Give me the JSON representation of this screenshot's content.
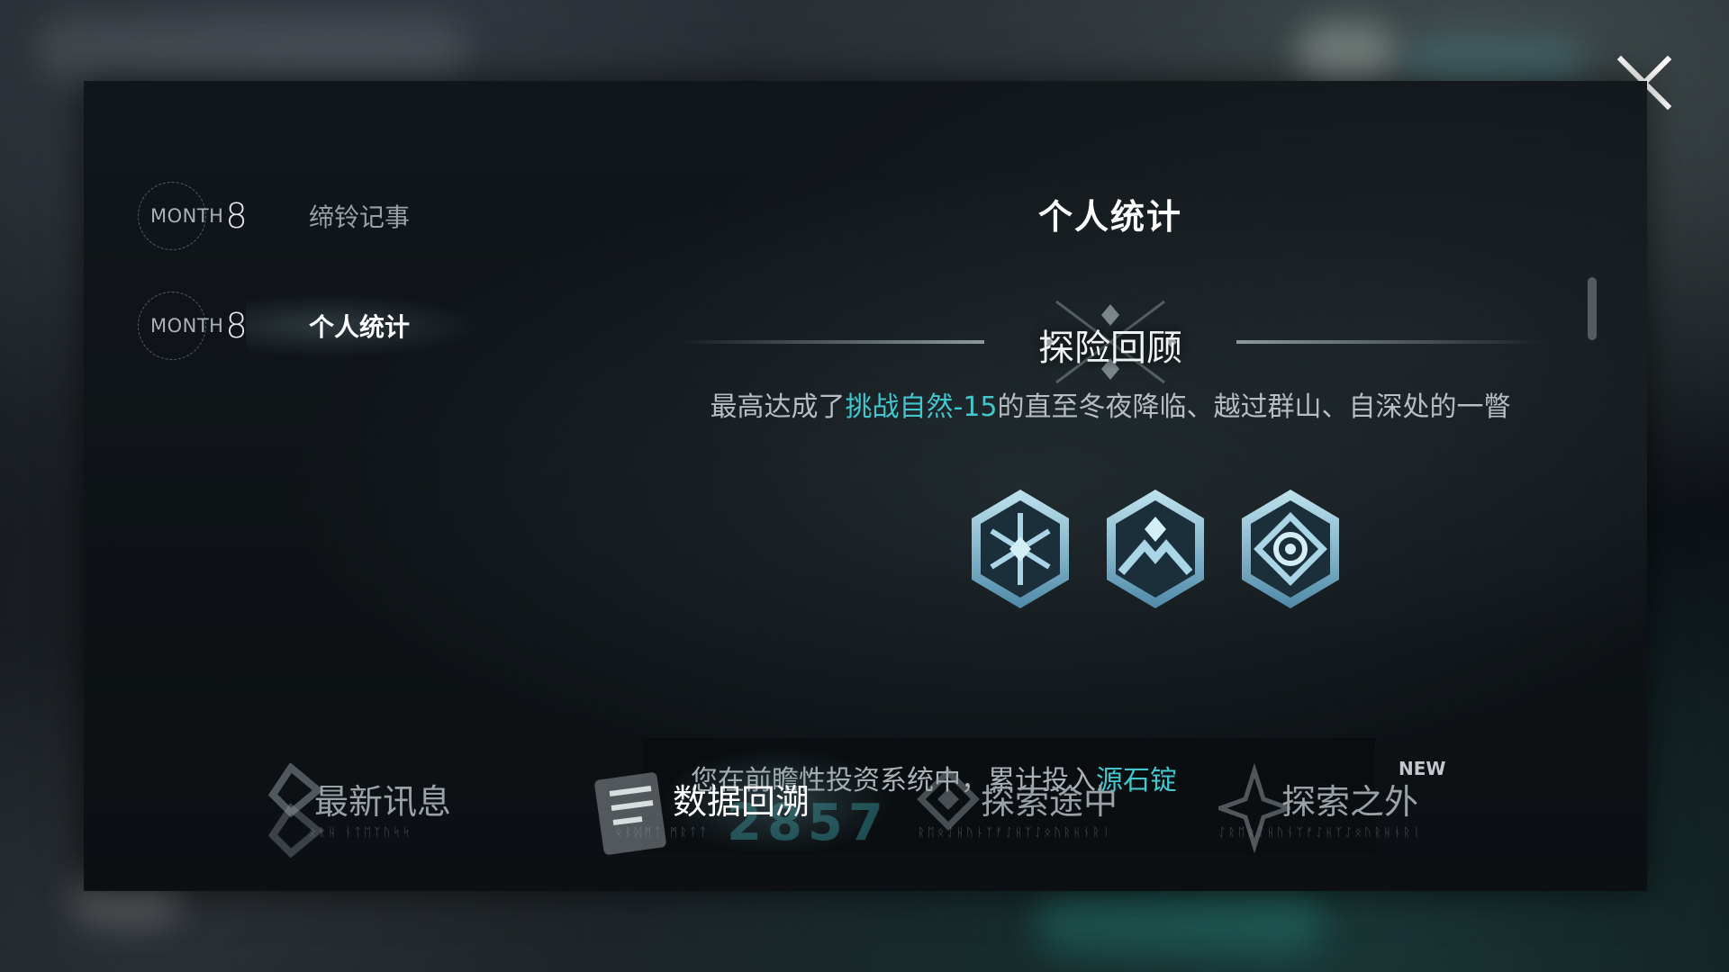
{
  "window": {
    "close_icon": "close-icon"
  },
  "side_nav": {
    "items": [
      {
        "month_word": "MONTH",
        "month_num": "8",
        "label": "缔铃记事",
        "active": false
      },
      {
        "month_word": "MONTH",
        "month_num": "8",
        "label": "个人统计",
        "active": true
      }
    ]
  },
  "content": {
    "title": "个人统计",
    "section_title": "探险回顾",
    "achievement": {
      "prefix": "最高达成了",
      "highlight": "挑战自然-15",
      "suffix": "的直至冬夜降临、越过群山、自深处的一瞥"
    },
    "badges": [
      "winter-night-badge-icon",
      "mountains-badge-icon",
      "depths-eye-badge-icon"
    ],
    "invest": {
      "prefix": "您在前瞻性投资系统中，累计投入",
      "highlight": "源石锭",
      "number": "2857"
    }
  },
  "bottom_tabs": [
    {
      "label": "最新讯息",
      "runes": "ᛟᚱᚺ ᚾᛏᛖᛉᚢᛋᛋ",
      "icon": "news-icon",
      "active": false,
      "new": ""
    },
    {
      "label": "数据回溯",
      "runes": "ᛟᛒᛞᛗᛏ ᛗᚱᛏᛏ",
      "icon": "data-review-icon",
      "active": true,
      "new": ""
    },
    {
      "label": "探索途中",
      "runes": "ᚱᛖᛟᛇᚺᚢᚾᛉᚠᛇᚺᛉᛇᛟᚢᚱᚺᚾᚱᛁ",
      "icon": "exploring-icon",
      "active": false,
      "new": ""
    },
    {
      "label": "探索之外",
      "runes": "ᛇᚱᛖᛟᛇᚺᚢᚾᛉᚠᛇᚺᛉᛇᛟᚢᚱᚺᚾᚱᛁ",
      "icon": "beyond-exploration-icon",
      "active": false,
      "new": "NEW"
    }
  ],
  "colors": {
    "accent": "#43c7cf",
    "text": "#d8dde0",
    "muted": "#9aa2a6"
  }
}
